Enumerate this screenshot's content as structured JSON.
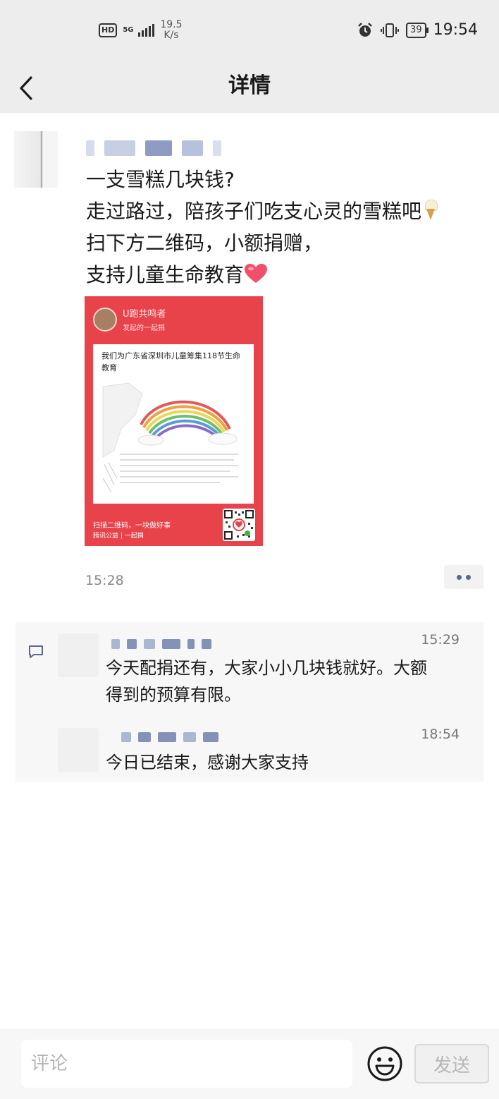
{
  "status_bar": {
    "hd": "HD",
    "network": "5G",
    "net_speed": "19.5",
    "net_speed_unit": "K/s",
    "battery": "39",
    "time": "19:54"
  },
  "header": {
    "title": "详情"
  },
  "post": {
    "lines": [
      "一支雪糕几块钱?",
      "走过路过，陪孩子们吃支心灵的雪糕吧",
      "扫下方二维码，小额捐赠，",
      "支持儿童生命教育"
    ],
    "time": "15:28",
    "shared_image": {
      "user": "U跑共鸣者",
      "subtitle": "发起的一起捐",
      "headline": "我们为广东省深圳市儿童筹集118节生命教育",
      "footer_line1": "扫描二维码，一块做好事",
      "footer_line2": "腾讯公益 | 一起捐"
    }
  },
  "comments": [
    {
      "time": "15:29",
      "text_lines": [
        "今天配捐还有，大家小小几块钱就好。大额",
        "得到的预算有限。"
      ]
    },
    {
      "time": "18:54",
      "text_lines": [
        "今日已结束，感谢大家支持"
      ]
    }
  ],
  "bottom_bar": {
    "placeholder": "评论",
    "send_label": "发送"
  },
  "colors": {
    "poster_red": "#e8434a",
    "link_blue": "#58698c"
  }
}
